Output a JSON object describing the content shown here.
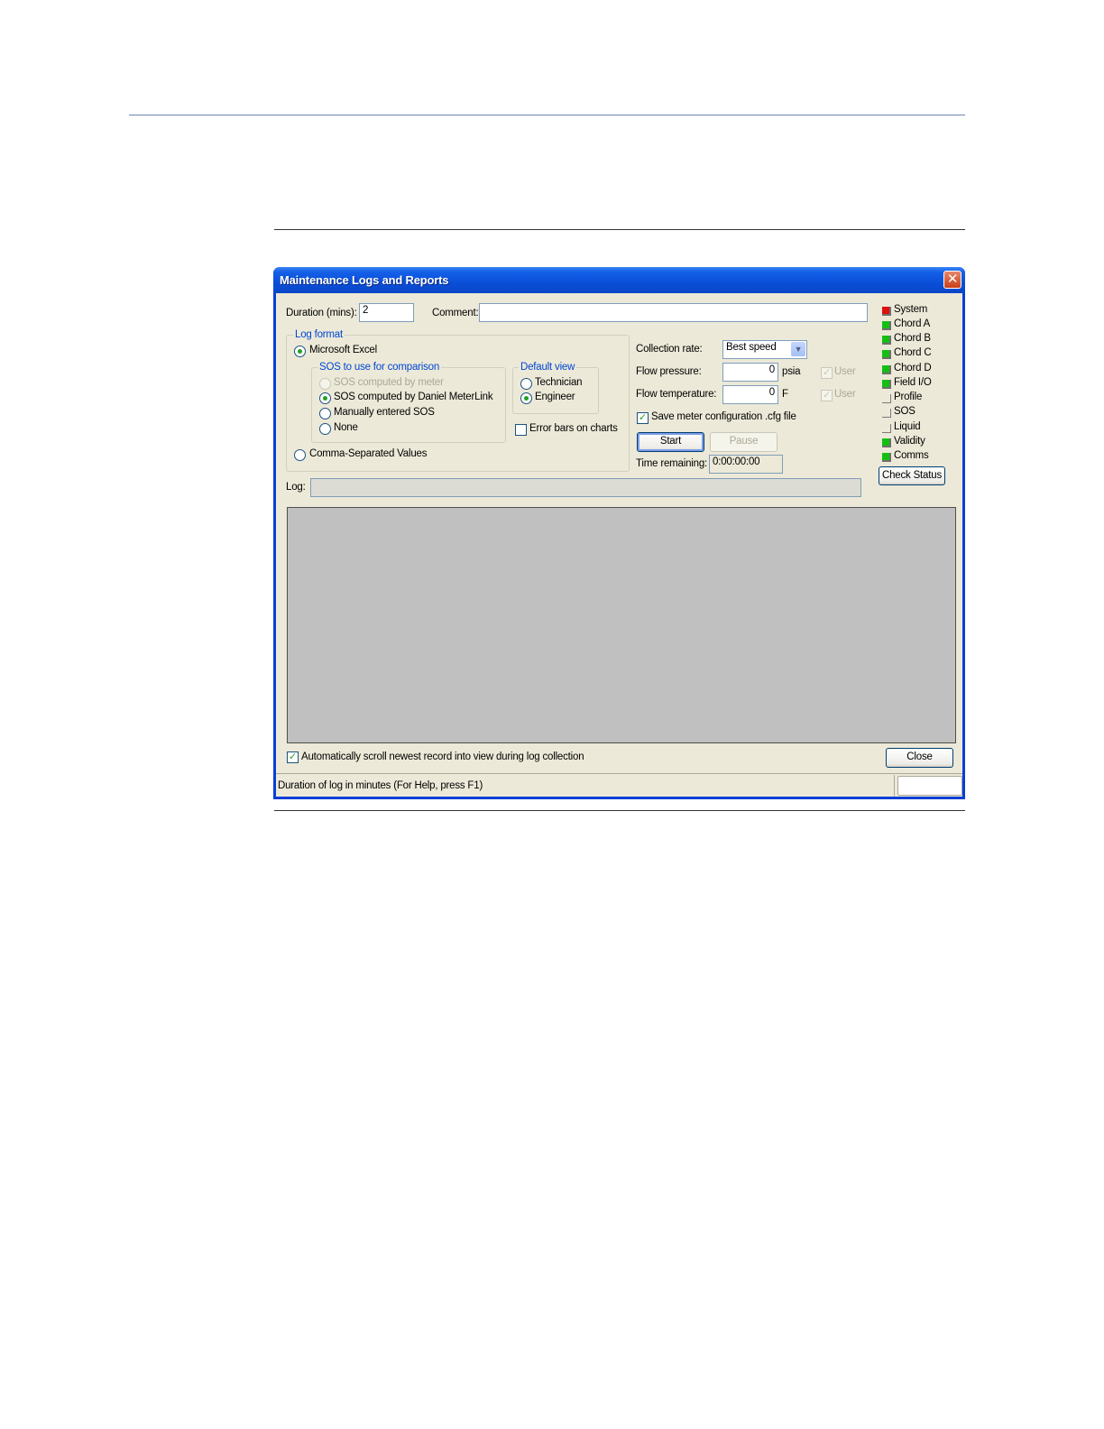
{
  "window": {
    "title": "Maintenance Logs and Reports"
  },
  "duration": {
    "label": "Duration (mins):",
    "value": "2"
  },
  "comment": {
    "label": "Comment:",
    "value": ""
  },
  "log_format": {
    "title": "Log format",
    "excel_label": "Microsoft Excel",
    "csv_label": "Comma-Separated Values",
    "selected": "Microsoft Excel"
  },
  "sos": {
    "title": "SOS to use for comparison",
    "options": [
      "SOS computed by meter",
      "SOS computed by Daniel MeterLink",
      "Manually entered SOS",
      "None"
    ],
    "selected": "SOS computed by Daniel MeterLink"
  },
  "default_view": {
    "title": "Default view",
    "options": [
      "Technician",
      "Engineer"
    ],
    "selected": "Engineer"
  },
  "error_bars": {
    "label": "Error bars on charts",
    "checked": false
  },
  "collection_rate": {
    "label": "Collection rate:",
    "value": "Best speed"
  },
  "flow_pressure": {
    "label": "Flow pressure:",
    "value": "0",
    "unit": "psia",
    "user_label": "User"
  },
  "flow_temperature": {
    "label": "Flow temperature:",
    "value": "0",
    "unit": "F",
    "user_label": "User"
  },
  "save_config": {
    "label": "Save meter configuration .cfg file",
    "checked": true
  },
  "buttons": {
    "start": "Start",
    "pause": "Pause",
    "check_status": "Check Status",
    "close": "Close"
  },
  "time_remaining": {
    "label": "Time remaining:",
    "value": "0:00:00:00"
  },
  "log": {
    "label": "Log:",
    "path": ""
  },
  "status_indicators": [
    {
      "name": "System",
      "color": "#e01010"
    },
    {
      "name": "Chord A",
      "color": "#11c011"
    },
    {
      "name": "Chord B",
      "color": "#11c011"
    },
    {
      "name": "Chord C",
      "color": "#11c011"
    },
    {
      "name": "Chord D",
      "color": "#11c011"
    },
    {
      "name": "Field I/O",
      "color": "#11c011"
    },
    {
      "name": "Profile",
      "color": "#ece9d8"
    },
    {
      "name": "SOS",
      "color": "#ece9d8"
    },
    {
      "name": "Liquid",
      "color": "#ece9d8"
    },
    {
      "name": "Validity",
      "color": "#11c011"
    },
    {
      "name": "Comms",
      "color": "#11c011"
    }
  ],
  "auto_scroll": {
    "label": "Automatically scroll newest record into view during log collection",
    "checked": true
  },
  "statusbar": {
    "text": "Duration of log in minutes (For Help, press F1)"
  }
}
